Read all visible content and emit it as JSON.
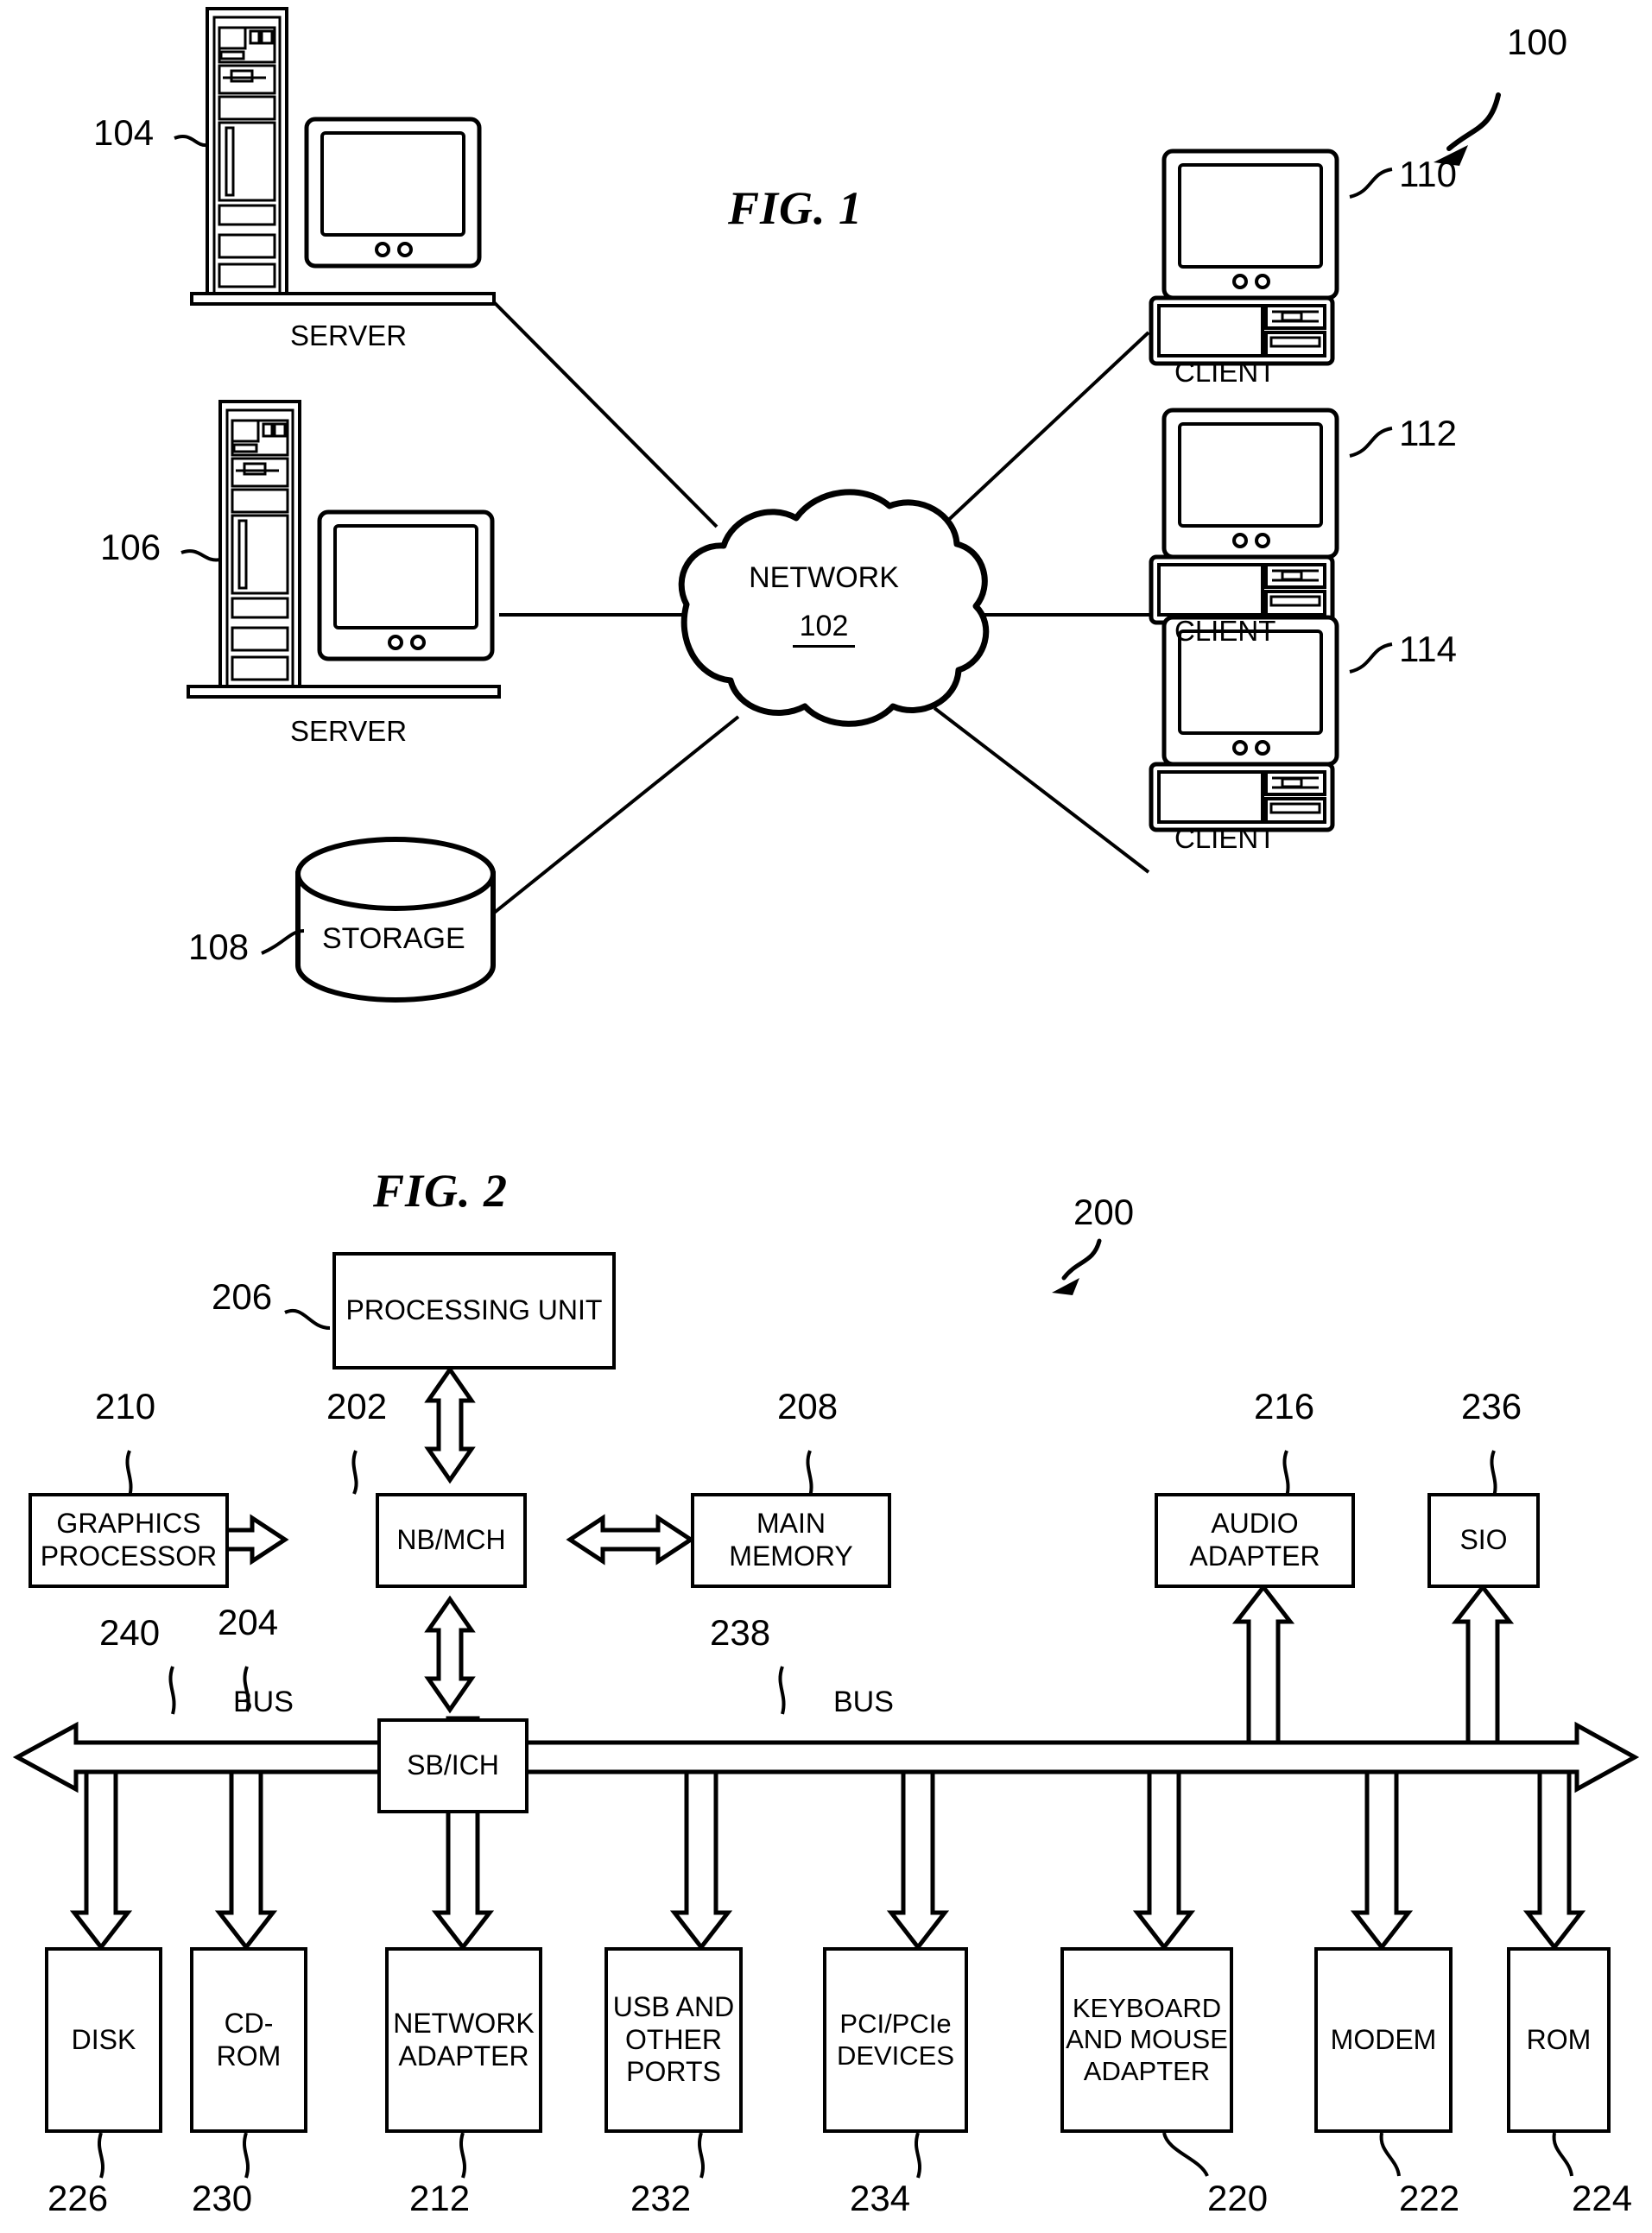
{
  "figures": [
    {
      "id": "fig1",
      "title": "FIG. 1",
      "system_ref": "100",
      "network": {
        "label": "NETWORK",
        "ref": "102"
      },
      "nodes": [
        {
          "name": "server-1",
          "label": "SERVER",
          "ref": "104"
        },
        {
          "name": "server-2",
          "label": "SERVER",
          "ref": "106"
        },
        {
          "name": "storage",
          "label": "STORAGE",
          "ref": "108"
        },
        {
          "name": "client-1",
          "label": "CLIENT",
          "ref": "110"
        },
        {
          "name": "client-2",
          "label": "CLIENT",
          "ref": "112"
        },
        {
          "name": "client-3",
          "label": "CLIENT",
          "ref": "114"
        }
      ]
    },
    {
      "id": "fig2",
      "title": "FIG. 2",
      "system_ref": "200",
      "blocks": [
        {
          "name": "processing-unit",
          "label": "PROCESSING UNIT",
          "ref": "206"
        },
        {
          "name": "nb-mch",
          "label": "NB/MCH",
          "ref": "202"
        },
        {
          "name": "graphics-processor",
          "label": "GRAPHICS PROCESSOR",
          "ref": "210"
        },
        {
          "name": "main-memory",
          "label": "MAIN MEMORY",
          "ref": "208"
        },
        {
          "name": "audio-adapter",
          "label": "AUDIO ADAPTER",
          "ref": "216"
        },
        {
          "name": "sio",
          "label": "SIO",
          "ref": "236"
        },
        {
          "name": "sb-ich",
          "label": "SB/ICH",
          "ref": "204"
        },
        {
          "name": "disk",
          "label": "DISK",
          "ref": "226"
        },
        {
          "name": "cd-rom",
          "label": "CD-ROM",
          "ref": "230"
        },
        {
          "name": "network-adapter",
          "label": "NETWORK ADAPTER",
          "ref": "212"
        },
        {
          "name": "usb-and-other-ports",
          "label": "USB AND OTHER PORTS",
          "ref": "232"
        },
        {
          "name": "pci-pcie-devices",
          "label": "PCI/PCIe DEVICES",
          "ref": "234"
        },
        {
          "name": "keyboard-and-mouse-adapter",
          "label": "KEYBOARD AND MOUSE ADAPTER",
          "ref": "220"
        },
        {
          "name": "modem",
          "label": "MODEM",
          "ref": "222"
        },
        {
          "name": "rom",
          "label": "ROM",
          "ref": "224"
        }
      ],
      "buses": [
        {
          "name": "bus-left",
          "label": "BUS",
          "ref": "240"
        },
        {
          "name": "bus-right",
          "label": "BUS",
          "ref": "238"
        }
      ]
    }
  ],
  "fig1": {
    "title": "FIG. 1",
    "system_ref": "100",
    "network_label": "NETWORK",
    "network_ref": "102",
    "server1_label": "SERVER",
    "server1_ref": "104",
    "server2_label": "SERVER",
    "server2_ref": "106",
    "storage_label": "STORAGE",
    "storage_ref": "108",
    "client1_label": "CLIENT",
    "client1_ref": "110",
    "client2_label": "CLIENT",
    "client2_ref": "112",
    "client3_label": "CLIENT",
    "client3_ref": "114"
  },
  "fig2": {
    "title": "FIG. 2",
    "system_ref": "200",
    "processing_unit": "PROCESSING UNIT",
    "processing_unit_ref": "206",
    "nb_mch": "NB/MCH",
    "nb_mch_ref": "202",
    "graphics_processor": "GRAPHICS PROCESSOR",
    "graphics_processor_ref": "210",
    "main_memory": "MAIN MEMORY",
    "main_memory_ref": "208",
    "audio_adapter": "AUDIO ADAPTER",
    "audio_adapter_ref": "216",
    "sio": "SIO",
    "sio_ref": "236",
    "sb_ich": "SB/ICH",
    "sb_ich_ref": "204",
    "bus_left_label": "BUS",
    "bus_left_ref": "240",
    "bus_right_label": "BUS",
    "bus_right_ref": "238",
    "disk": "DISK",
    "disk_ref": "226",
    "cd_rom": "CD-ROM",
    "cd_rom_ref": "230",
    "network_adapter": "NETWORK ADAPTER",
    "network_adapter_ref": "212",
    "usb_ports": "USB AND OTHER PORTS",
    "usb_ports_ref": "232",
    "pci_devices": "PCI/PCIe DEVICES",
    "pci_devices_ref": "234",
    "keyboard_mouse": "KEYBOARD AND MOUSE ADAPTER",
    "keyboard_mouse_ref": "220",
    "modem": "MODEM",
    "modem_ref": "222",
    "rom": "ROM",
    "rom_ref": "224"
  },
  "colors": {
    "ink": "#000000",
    "paper": "#ffffff"
  }
}
